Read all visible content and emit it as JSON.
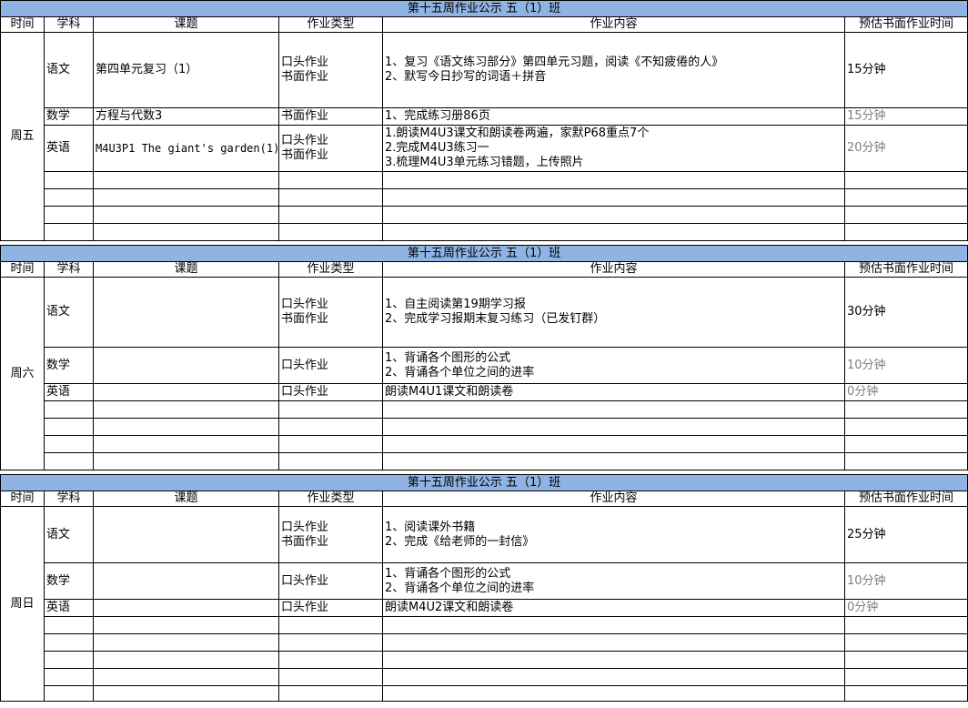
{
  "headers": [
    "时间",
    "学科",
    "课题",
    "作业类型",
    "作业内容",
    "预估书面作业时间"
  ],
  "blocks": [
    {
      "title": "第十五周作业公示 五（1）班",
      "day": "周五",
      "rows": [
        {
          "subject": "语文",
          "topic": "第四单元复习（1）",
          "type": [
            "口头作业",
            "书面作业"
          ],
          "content": [
            "1、复习《语文练习部分》第四单元习题，阅读《不知疲倦的人》",
            "2、默写今日抄写的词语＋拼音"
          ],
          "time": "15分钟"
        },
        {
          "subject": "数学",
          "topic": "方程与代数3",
          "type": [
            "书面作业"
          ],
          "content": [
            "1、完成练习册86页"
          ],
          "time": "15分钟"
        },
        {
          "subject": "英语",
          "topic": "M4U3P1 The giant's garden(1)",
          "type": [
            "口头作业",
            "书面作业"
          ],
          "content": [
            "1.朗读M4U3课文和朗读卷两遍，家默P68重点7个",
            "2.完成M4U3练习一",
            "3.梳理M4U3单元练习错题，上传照片"
          ],
          "time": "20分钟"
        }
      ]
    },
    {
      "title": "第十五周作业公示 五（1）班",
      "day": "周六",
      "rows": [
        {
          "subject": "语文",
          "topic": "",
          "type": [
            "口头作业",
            "书面作业"
          ],
          "content": [
            "1、自主阅读第19期学习报",
            "2、完成学习报期末复习练习（已发钉群）"
          ],
          "time": "30分钟"
        },
        {
          "subject": "数学",
          "topic": "",
          "type": [
            "口头作业"
          ],
          "content": [
            "1、背诵各个图形的公式",
            "2、背诵各个单位之间的进率"
          ],
          "time": "10分钟"
        },
        {
          "subject": "英语",
          "topic": "",
          "type": [
            "口头作业"
          ],
          "content": [
            "朗读M4U1课文和朗读卷"
          ],
          "time": "0分钟"
        }
      ]
    },
    {
      "title": "第十五周作业公示 五（1）班",
      "day": "周日",
      "rows": [
        {
          "subject": "语文",
          "topic": "",
          "type": [
            "口头作业",
            "书面作业"
          ],
          "content": [
            "1、阅读课外书籍",
            "2、完成《给老师的一封信》"
          ],
          "time": "25分钟"
        },
        {
          "subject": "数学",
          "topic": "",
          "type": [
            "口头作业"
          ],
          "content": [
            "1、背诵各个图形的公式",
            "2、背诵各个单位之间的进率"
          ],
          "time": "10分钟"
        },
        {
          "subject": "英语",
          "topic": "",
          "type": [
            "口头作业"
          ],
          "content": [
            "朗读M4U2课文和朗读卷"
          ],
          "time": "0分钟"
        }
      ]
    }
  ]
}
